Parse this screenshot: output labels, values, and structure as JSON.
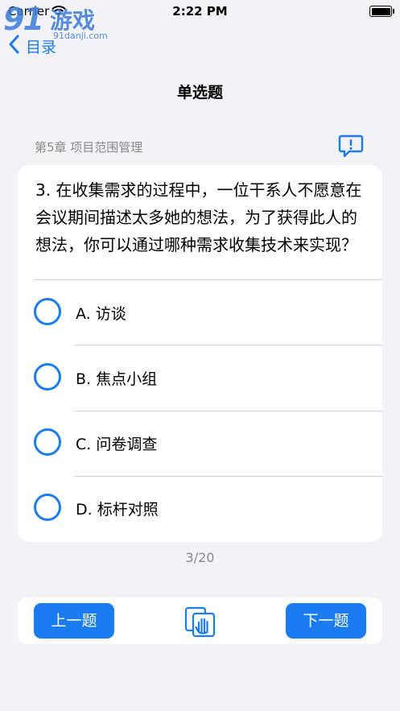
{
  "status_bar": {
    "carrier": "Carrier",
    "time": "2:22 PM"
  },
  "watermark": {
    "number": "91",
    "text": "游戏",
    "url": "91danji.com"
  },
  "nav": {
    "back_label": "目录",
    "title": "单选题"
  },
  "chapter": "第5章 项目范围管理",
  "question": {
    "text": "3. 在收集需求的过程中，一位干系人不愿意在会议期间描述太多她的想法，为了获得此人的想法，你可以通过哪种需求收集技术来实现？"
  },
  "options": [
    {
      "label": "A. 访谈"
    },
    {
      "label": "B. 焦点小组"
    },
    {
      "label": "C. 问卷调查"
    },
    {
      "label": "D. 标杆对照"
    }
  ],
  "progress": "3/20",
  "buttons": {
    "prev": "上一题",
    "next": "下一题"
  },
  "colors": {
    "accent": "#1A7CF0",
    "background": "#F2F2F7"
  }
}
